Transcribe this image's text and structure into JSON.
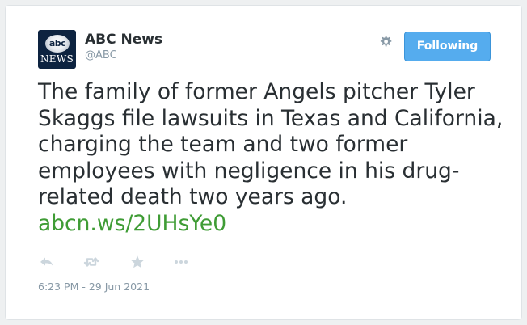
{
  "account": {
    "name": "ABC News",
    "handle": "@ABC",
    "avatar_logo_text": "abc",
    "avatar_news_text": "NEWS"
  },
  "header": {
    "settings_icon": "gear-icon",
    "follow_label": "Following"
  },
  "tweet": {
    "text": "The family of former Angels pitcher Tyler Skaggs file lawsuits in Texas and California, charging the team and two former employees with negligence in his drug-related death two years ago.",
    "link": "abcn.ws/2UHsYe0",
    "timestamp": "6:23 PM - 29 Jun 2021"
  },
  "actions": [
    {
      "name": "reply",
      "icon": "reply-icon"
    },
    {
      "name": "retweet",
      "icon": "retweet-icon"
    },
    {
      "name": "like",
      "icon": "star-icon"
    },
    {
      "name": "more",
      "icon": "more-icon"
    }
  ],
  "colors": {
    "link": "#3f9c35",
    "follow_button": "#55acee",
    "text": "#292f33",
    "muted": "#8899a6",
    "icon": "#ccd6dd",
    "avatar_bg": "#0d2340"
  }
}
